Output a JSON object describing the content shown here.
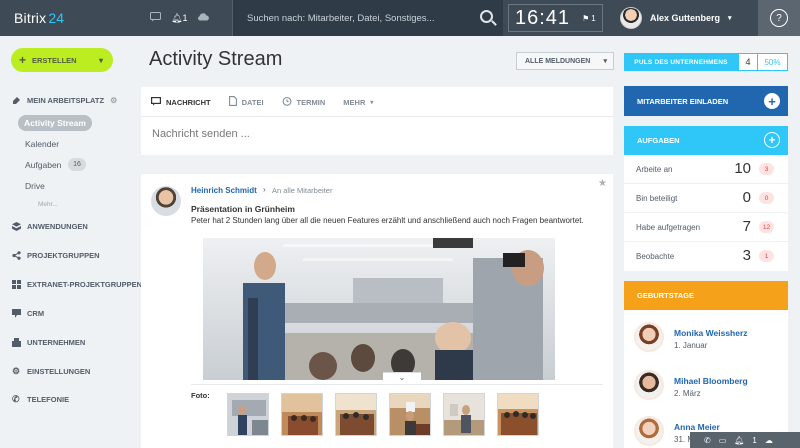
{
  "header": {
    "logo_name": "Bitrix",
    "logo_num": "24",
    "chat_icon": "chat-icon",
    "notif_count": "1",
    "search_placeholder": "Suchen nach: Mitarbeiter, Datei, Sonstiges...",
    "time": "16:41",
    "time_flag": "1",
    "user_name": "Alex Guttenberg",
    "help_label": "?"
  },
  "sidebar": {
    "create_label": "ERSTELLEN",
    "sections": [
      {
        "label": "MEIN ARBEITSPLATZ",
        "icon": "workplace-icon"
      },
      {
        "label": "ANWENDUNGEN",
        "icon": "apps-icon"
      },
      {
        "label": "PROJEKTGRUPPEN",
        "icon": "share-icon"
      },
      {
        "label": "EXTRANET-PROJEKTGRUPPEN",
        "icon": "extranet-icon"
      },
      {
        "label": "CRM",
        "icon": "crm-icon"
      },
      {
        "label": "UNTERNEHMEN",
        "icon": "company-icon"
      },
      {
        "label": "EINSTELLUNGEN",
        "icon": "gear-icon"
      },
      {
        "label": "TELEFONIE",
        "icon": "phone-icon"
      }
    ],
    "sub_items": [
      {
        "label": "Activity Stream",
        "active": true
      },
      {
        "label": "Kalender"
      },
      {
        "label": "Aufgaben",
        "count": "16"
      },
      {
        "label": "Drive"
      }
    ],
    "more_label": "Mehr..."
  },
  "main": {
    "title": "Activity Stream",
    "filter_label": "ALLE MELDUNGEN",
    "form_tabs": [
      {
        "label": "NACHRICHT",
        "icon": "message-icon"
      },
      {
        "label": "DATEI",
        "icon": "file-icon"
      },
      {
        "label": "TERMIN",
        "icon": "clock-icon"
      },
      {
        "label": "MEHR"
      }
    ],
    "form_placeholder": "Nachricht senden ...",
    "post": {
      "author": "Heinrich Schmidt",
      "recipient": "An alle Mitarbeiter",
      "title": "Präsentation in Grünheim",
      "text": "Peter hat 2 Stunden lang über all die neuen Features erzählt und anschließend auch noch Fragen beantwortet.",
      "foto_label": "Foto:"
    }
  },
  "right": {
    "pulse_label": "PULS DES UNTERNEHMENS",
    "pulse_num": "4",
    "pulse_pct": "50%",
    "invite_label": "MITARBEITER EINLADEN",
    "tasks_label": "AUFGABEN",
    "tasks": [
      {
        "label": "Arbeite an",
        "count": "10",
        "badge": "3"
      },
      {
        "label": "Bin beteiligt",
        "count": "0",
        "badge": "0"
      },
      {
        "label": "Habe aufgetragen",
        "count": "7",
        "badge": "12"
      },
      {
        "label": "Beobachte",
        "count": "3",
        "badge": "1"
      }
    ],
    "birthdays_label": "GEBURTSTAGE",
    "birthdays": [
      {
        "name": "Monika Weissherz",
        "date": "1. Januar"
      },
      {
        "name": "Mihael Bloomberg",
        "date": "2. März"
      },
      {
        "name": "Anna Meier",
        "date": "31. M"
      }
    ]
  },
  "colors": {
    "header": "#3e4a56",
    "accent_green": "#bbed21",
    "accent_blue": "#2067b0",
    "accent_cyan": "#2fc7f7",
    "accent_orange": "#f6a11a"
  }
}
